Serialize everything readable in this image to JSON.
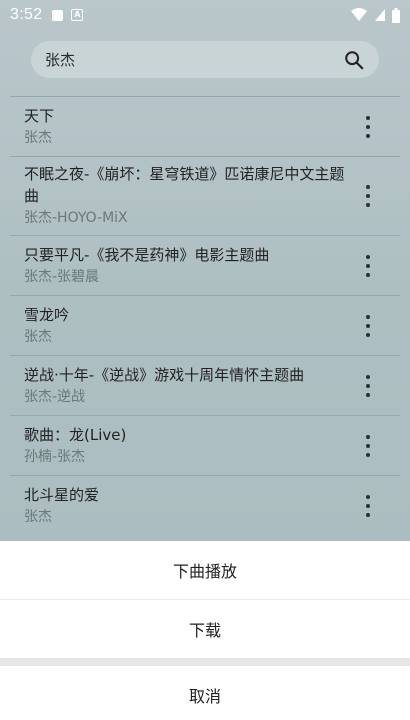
{
  "status_bar": {
    "time": "3:52",
    "icons": [
      "notification-square-icon",
      "a-app-icon",
      "wifi-icon",
      "signal-icon",
      "battery-icon"
    ]
  },
  "search": {
    "query": "张杰",
    "icon": "search-icon"
  },
  "songs": [
    {
      "title": "天下",
      "artist": "张杰"
    },
    {
      "title": "不眠之夜-《崩坏：星穹铁道》匹诺康尼中文主题曲",
      "artist": "张杰-HOYO-MiX"
    },
    {
      "title": "只要平凡-《我不是药神》电影主题曲",
      "artist": "张杰-张碧晨"
    },
    {
      "title": "雪龙吟",
      "artist": "张杰"
    },
    {
      "title": "逆战·十年-《逆战》游戏十周年情怀主题曲",
      "artist": "张杰-逆战"
    },
    {
      "title": "歌曲：龙(Live)",
      "artist": "孙楠-张杰"
    },
    {
      "title": "北斗星的爱",
      "artist": "张杰"
    }
  ],
  "sheet": {
    "play_next": "下曲播放",
    "download": "下载",
    "cancel": "取消"
  },
  "colors": {
    "overlay_tint": "#aebfc2",
    "sheet_bg": "#ffffff"
  }
}
